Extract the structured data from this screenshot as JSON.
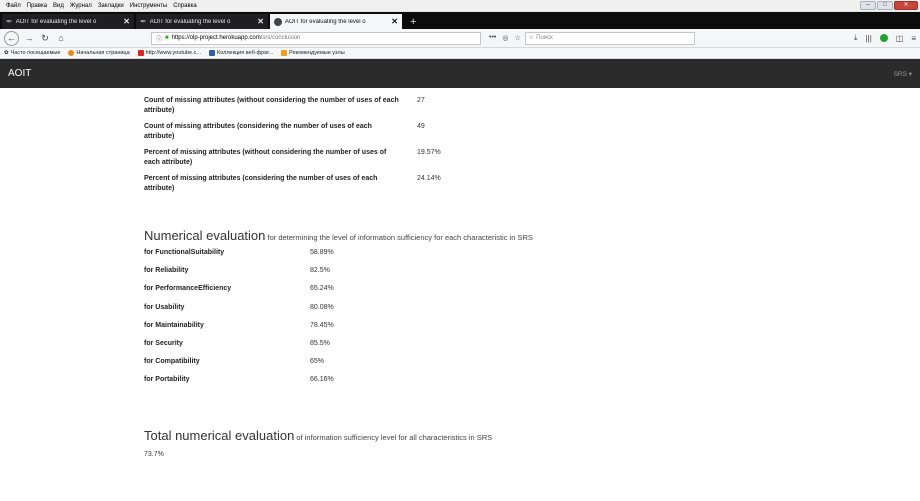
{
  "browser": {
    "menu": [
      "Файл",
      "Правка",
      "Вид",
      "Журнал",
      "Закладки",
      "Инструменты",
      "Справка"
    ],
    "tabs": [
      {
        "title": "AOIT for evaluating the level o"
      },
      {
        "title": "AOIT for evaluating the level o"
      },
      {
        "title": "AOIT for evaluating the level o"
      }
    ],
    "url_host": "https://olp-project.herokuapp.com",
    "url_path": "/srs/conclusion",
    "search_placeholder": "Поиск",
    "bookmarks": [
      "Часто посещаемые",
      "Начальная страница",
      "http://www.youtube.c...",
      "Коллекция веб-фраг...",
      "Рекомендуемые узлы"
    ]
  },
  "app": {
    "brand": "AOIT",
    "menu_label": "SRS ▾"
  },
  "missing": [
    {
      "label": "Count of missing attributes (without considering the number of uses of each attribute)",
      "value": "27"
    },
    {
      "label": "Count of missing attributes (considering the number of uses of each attribute)",
      "value": "49"
    },
    {
      "label": "Percent of missing attributes (without considering the number of uses of each attribute)",
      "value": "19.57%"
    },
    {
      "label": "Percent of missing attributes (considering the number of uses of each attribute)",
      "value": "24.14%"
    }
  ],
  "numerical": {
    "title": "Numerical evaluation",
    "subtitle": "for determining the level of information sufficiency for each characteristic in SRS",
    "rows": [
      {
        "label": "for FunctionalSuitability",
        "value": "58.89%"
      },
      {
        "label": "for Reliability",
        "value": "82.5%"
      },
      {
        "label": "for PerformanceEfficiency",
        "value": "65.24%"
      },
      {
        "label": "for Usability",
        "value": "80.08%"
      },
      {
        "label": "for Maintainability",
        "value": "78.45%"
      },
      {
        "label": "for Security",
        "value": "85.5%"
      },
      {
        "label": "for Compatibility",
        "value": "65%"
      },
      {
        "label": "for Portability",
        "value": "66.16%"
      }
    ]
  },
  "total": {
    "title": "Total numerical evaluation",
    "subtitle": "of information sufficiency level for all characteristics in SRS",
    "value": "73.7%"
  }
}
